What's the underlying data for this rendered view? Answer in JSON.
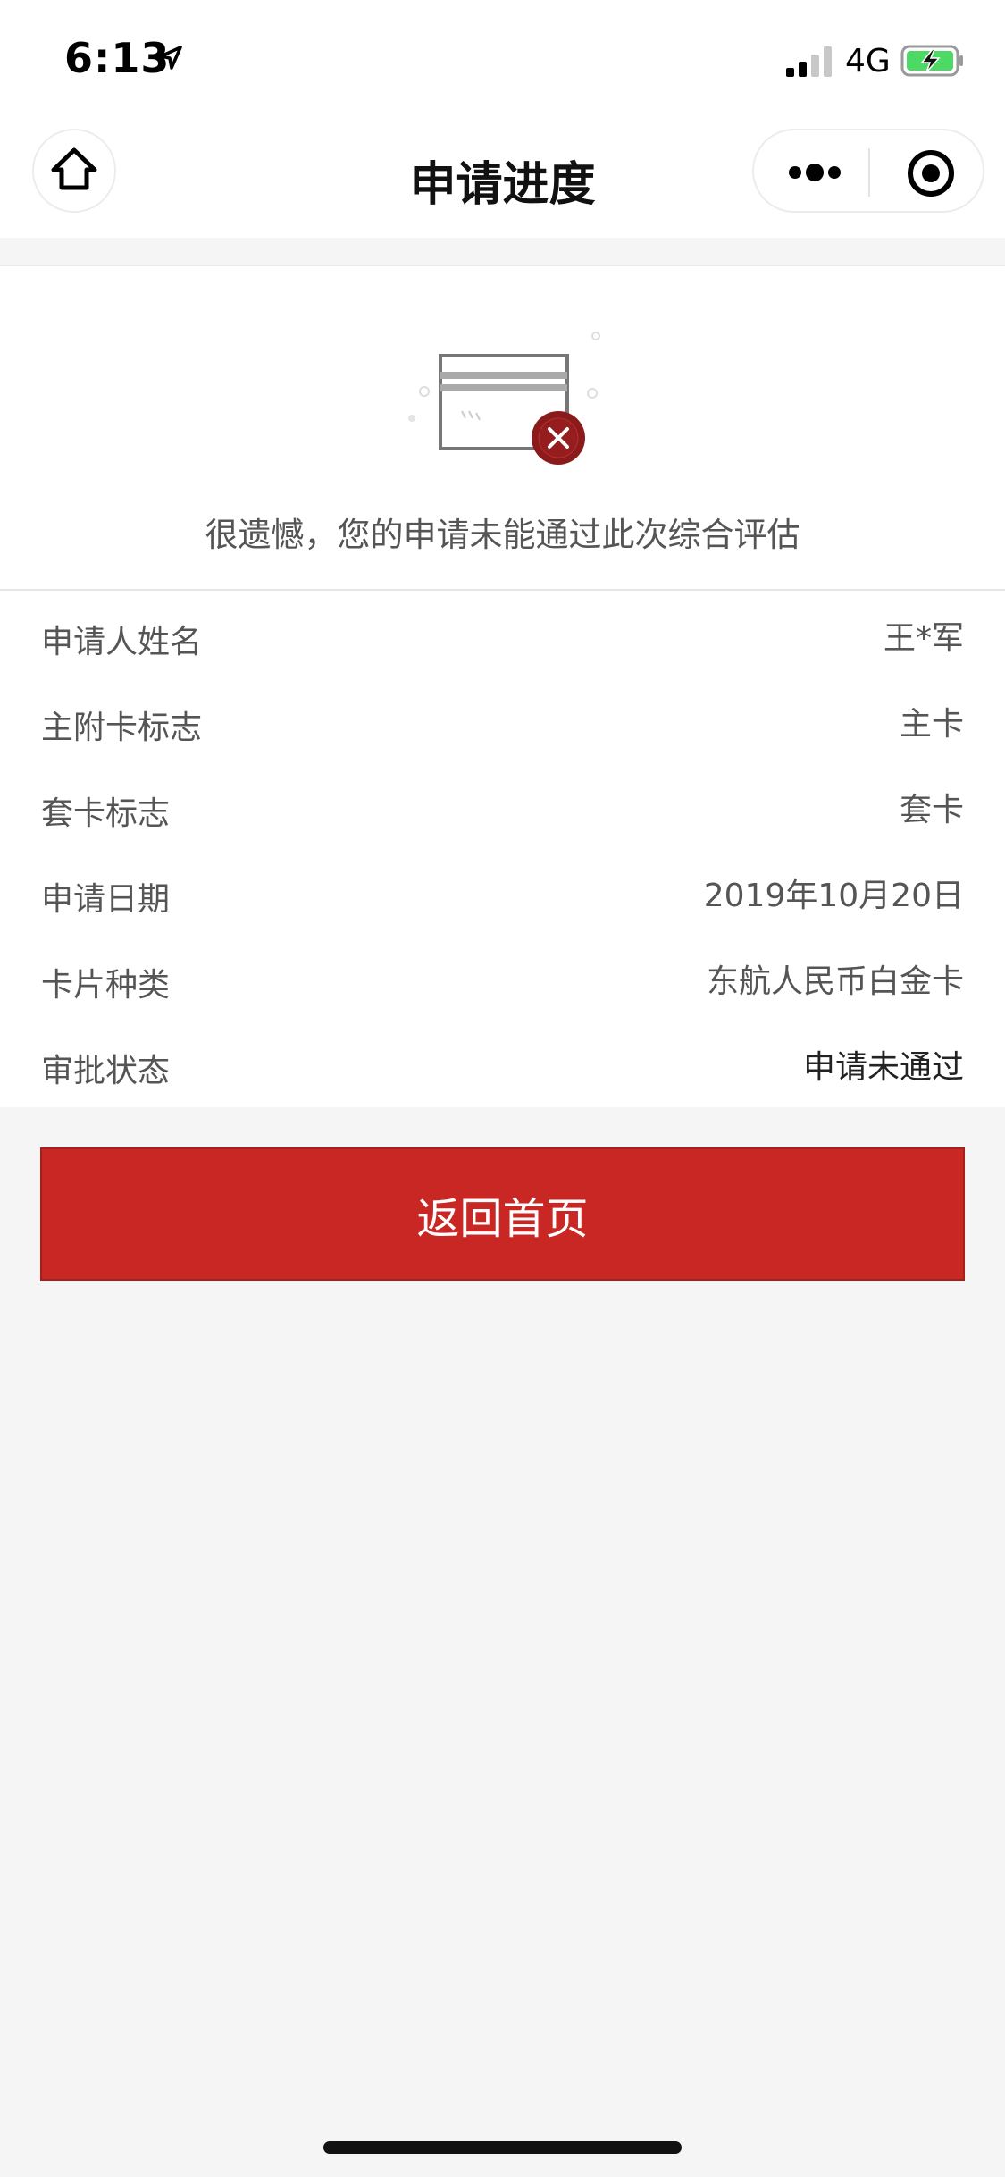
{
  "status_bar": {
    "time": "6:13",
    "network": "4G"
  },
  "nav": {
    "title": "申请进度",
    "home_icon": "home-icon",
    "more_icon": "more-dots-icon",
    "close_icon": "target-circle-icon"
  },
  "result": {
    "message": "很遗憾，您的申请未能通过此次综合评估",
    "illustration_icon": "card-rejected-icon",
    "status_color": "#8b1a1a"
  },
  "info": {
    "rows": [
      {
        "label": "申请人姓名",
        "value": "王*军"
      },
      {
        "label": "主附卡标志",
        "value": "主卡"
      },
      {
        "label": "套卡标志",
        "value": "套卡"
      },
      {
        "label": "申请日期",
        "value": "2019年10月20日"
      },
      {
        "label": "卡片种类",
        "value": "东航人民币白金卡"
      },
      {
        "label": "审批状态",
        "value": "申请未通过"
      }
    ]
  },
  "actions": {
    "return_home_label": "返回首页",
    "button_color": "#c92723"
  }
}
